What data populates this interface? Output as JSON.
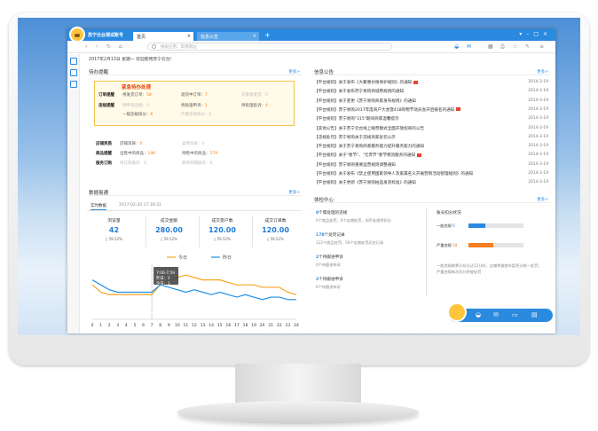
{
  "app": {
    "title": "苏宁云台测试账号",
    "tabs": [
      {
        "label": "首页"
      },
      {
        "label": "信息公告"
      }
    ],
    "search_placeholder": "搜索应用、常用网址",
    "welcome": "2017年2月13日 星期一 欢迎使用苏宁云台！"
  },
  "todo": {
    "title": "待办提醒",
    "more": "更多>",
    "urgent_title": "紧急待办处理",
    "orders": {
      "label": "订单提醒",
      "items": [
        {
          "k": "待发货订单：",
          "v": "58"
        },
        {
          "k": "退货中订单：",
          "v": "7"
        },
        {
          "k": "买家催发货：",
          "v": "0"
        }
      ]
    },
    "violations": {
      "label": "违规提醒",
      "items": [
        {
          "k": "待申诉违规：",
          "v": "0"
        },
        {
          "k": "待处理申诉：",
          "v": "1"
        },
        {
          "k": "待处理投诉：",
          "v": "4"
        },
        {
          "k": "一般违规扣分：",
          "v": "6"
        },
        {
          "k": "严重违规扣分：",
          "v": "0"
        }
      ]
    },
    "shop": {
      "label": "店铺资质",
      "items": [
        {
          "k": "店铺资质：",
          "v": "0"
        },
        {
          "k": "品牌资质：",
          "v": "0"
        }
      ]
    },
    "goods": {
      "label": "商品提醒",
      "items": [
        {
          "k": "出售中的商品：",
          "v": "146"
        },
        {
          "k": "待售中的商品：",
          "v": "579"
        }
      ]
    },
    "service": {
      "label": "服务订购",
      "items": [
        {
          "k": "待订购服务：",
          "v": "0"
        },
        {
          "k": "即将到期服务：",
          "v": "0"
        }
      ]
    }
  },
  "notices": {
    "title": "信息公告",
    "more": "更多>",
    "items": [
      {
        "text": "【平台规则】关于发布《大聚惠价格保护规则》的通知",
        "hot": true,
        "date": "2014-3-19"
      },
      {
        "text": "【平台规则】关于发布苏宁易购商城用规则的通知",
        "hot": false,
        "date": "2014-3-19"
      },
      {
        "text": "【平台规则】关于变更《苏宁易购商家发布规则》的通知",
        "hot": false,
        "date": "2014-3-19"
      },
      {
        "text": "【平台规则】苏宁易购2017年度商户大会暨418购物节动员会开启报名的通知",
        "hot": true,
        "date": "2014-3-19"
      },
      {
        "text": "【平台规则】苏宁易购\"315\"期间商家温馨提示",
        "hot": false,
        "date": "2014-3-19"
      },
      {
        "text": "【其他公告】关于苏宁云台线上联营模式全面开放招商的公告",
        "hot": false,
        "date": "2014-3-19"
      },
      {
        "text": "【违规处罚】苏宁易购关于违规商家处罚公示",
        "hot": false,
        "date": "2014-3-19"
      },
      {
        "text": "【平台规则】关于苏宁易购商家服务能力提升服务能力的通知",
        "hot": false,
        "date": "2014-3-19"
      },
      {
        "text": "【平台规则】关于\"春节\"、\"元宵节\"春节物流服务的通知",
        "hot": true,
        "date": "2014-3-19"
      },
      {
        "text": "【平台规则】苏宁易购重要运营规则调整通知",
        "hot": false,
        "date": "2014-3-19"
      },
      {
        "text": "【平台规则】关于发布《禁止使用国家领导人及家属名义开展营销活动管理规则》的通知",
        "hot": false,
        "date": "2014-3-19"
      },
      {
        "text": "【平台规则】关于更新《苏宁易购拍品发货标准》的通知",
        "hot": false,
        "date": "2014-3-19"
      }
    ]
  },
  "data": {
    "title": "数据易通",
    "more": "更多>",
    "tab": "实时数据",
    "time": "2017-02-20 17:18:31",
    "stats": [
      {
        "name": "浏览量",
        "value": "42",
        "pct": "59.52%"
      },
      {
        "name": "成交金额",
        "value": "280.00",
        "pct": "59.52%"
      },
      {
        "name": "成交客户数",
        "value": "120.00",
        "pct": "59.52%"
      },
      {
        "name": "成交订单数",
        "value": "120.00",
        "pct": "59.52%"
      }
    ],
    "legend": {
      "today": "今日",
      "yesterday": "昨日"
    },
    "tooltip": {
      "time": "7:00-7:59",
      "today": "昨日：1",
      "yesterday": "今日：1"
    }
  },
  "chart_data": {
    "type": "line",
    "x": [
      0,
      1,
      2,
      3,
      4,
      5,
      6,
      7,
      8,
      9,
      10,
      11,
      12,
      13,
      14,
      15,
      16,
      17,
      18,
      19,
      20,
      21,
      22,
      23,
      24
    ],
    "series": [
      {
        "name": "今日",
        "color": "#f5a623",
        "values": [
          14,
          11,
          10,
          10,
          10,
          10,
          10,
          10,
          14,
          16,
          17,
          18,
          17,
          16,
          16,
          16,
          15,
          14,
          14,
          14,
          13,
          13,
          13,
          11,
          10
        ]
      },
      {
        "name": "昨日",
        "color": "#1f8fe6",
        "values": [
          16,
          14,
          12,
          11,
          11,
          11,
          11,
          11,
          14,
          13,
          12,
          11,
          12,
          11,
          10,
          11,
          10,
          9,
          10,
          9,
          8,
          9,
          9,
          8,
          8
        ]
      }
    ],
    "xlabel": "",
    "ylabel": "",
    "grid": false,
    "legend": "top"
  },
  "check": {
    "title": "体检中心",
    "more": "更多>",
    "items": [
      {
        "head": "0",
        "head_text": "个需处理的违规",
        "sub": "0个商品处罚，0个店铺处罚，如不处理将扣分"
      },
      {
        "head": "178",
        "head_text": "个处罚记录",
        "sub": "122个商品处罚，56个店铺处罚历史记录"
      },
      {
        "head": "2",
        "head_text": "个待跟进申诉",
        "sub": "0个待跟进申诉"
      },
      {
        "head": "2",
        "head_text": "个待跟进申诉",
        "sub": "0个待跟进申诉"
      }
    ],
    "score_title": "账号扣分状况",
    "general": {
      "label": "一般违规",
      "value": "6",
      "pct": 0.3
    },
    "serious": {
      "label": "严重违规",
      "value": "18",
      "pct": 0.45
    },
    "note": "一般违规每累计扣分达12分时，店铺将被按年度积分统一处罚；严重违规每次扣分将被处罚"
  }
}
